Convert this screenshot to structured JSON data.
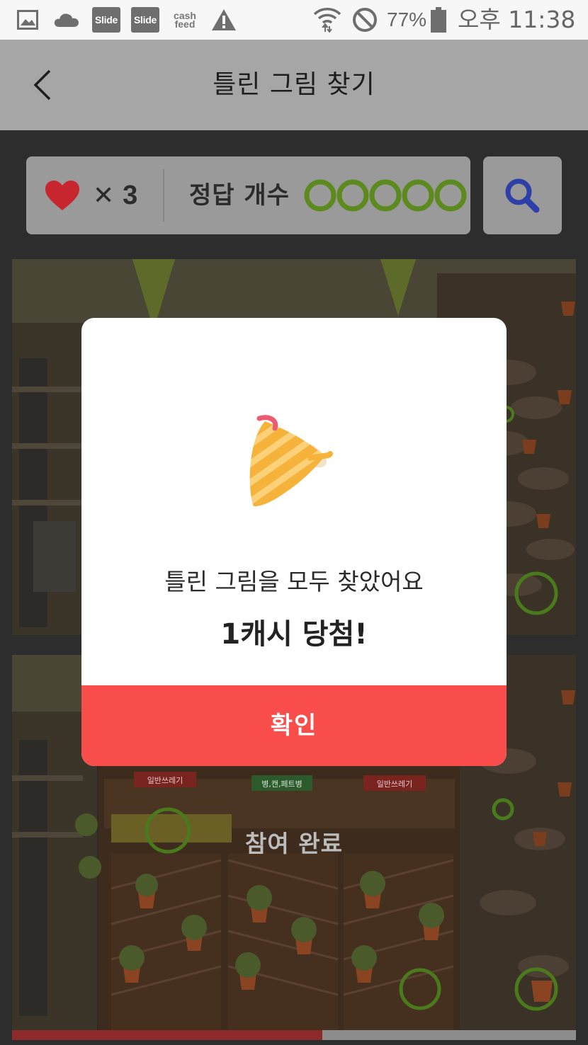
{
  "status_bar": {
    "slide_label_1": "Slide",
    "slide_label_2": "Slide",
    "cashfeed_line1": "cash",
    "cashfeed_line2": "feed",
    "battery": "77%",
    "time": "오후 11:38",
    "icons": [
      "gallery-icon",
      "cloud-icon",
      "slide-icon",
      "slide-icon",
      "cashfeed-icon",
      "warning-icon",
      "wifi-icon",
      "do-not-disturb-icon",
      "battery-icon"
    ]
  },
  "app_bar": {
    "title": "틀린 그림 찾기",
    "back_icon": "chevron-left-icon"
  },
  "info_bar": {
    "lives_icon": "heart-icon",
    "lives_multiplier": "✕",
    "lives_count": "3",
    "answer_label": "정답 개수",
    "answers_found": 5,
    "answers_total": 5,
    "search_icon": "magnifier-icon"
  },
  "game": {
    "overlay_label": "참여 완료",
    "progress_fraction": 0.55,
    "sign_labels": [
      "일반쓰레기",
      "병,캔,페트병",
      "일반쓰레기"
    ]
  },
  "dialog": {
    "illustration": "party-popper-icon",
    "message": "틀린 그림을 모두 찾았어요",
    "prize": "1캐시 당첨!",
    "confirm_label": "확인"
  },
  "colors": {
    "accent_red": "#f94d4b",
    "heart_red": "#c8262f",
    "circle_green": "#5c8a1e",
    "search_blue": "#2e3fa8"
  }
}
